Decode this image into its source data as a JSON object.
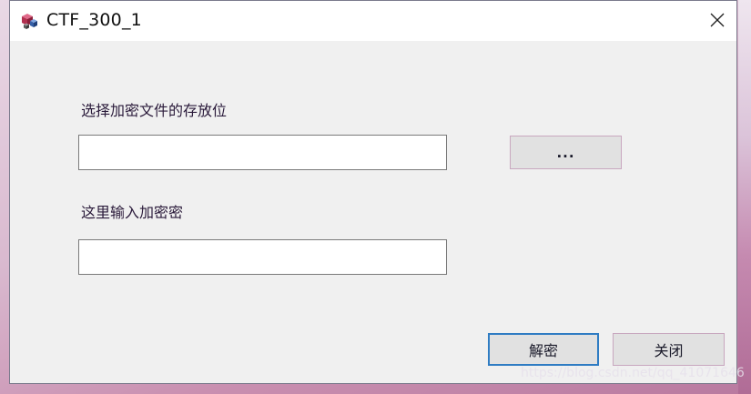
{
  "window": {
    "title": "CTF_300_1"
  },
  "form": {
    "path_label": "选择加密文件的存放位",
    "path_value": "",
    "browse_label": "...",
    "key_label": "这里输入加密密",
    "key_value": ""
  },
  "actions": {
    "decrypt_label": "解密",
    "close_label": "关闭"
  },
  "overlay": {
    "watermark_text": "https://blog.csdn.net/qq_41071646"
  },
  "icons": {
    "app": "app-cubes-icon",
    "close": "close-icon"
  },
  "colors": {
    "focus_border": "#2f7cc3",
    "button_bg": "#e1e1e1",
    "dialog_bg": "#f0f0f0"
  }
}
